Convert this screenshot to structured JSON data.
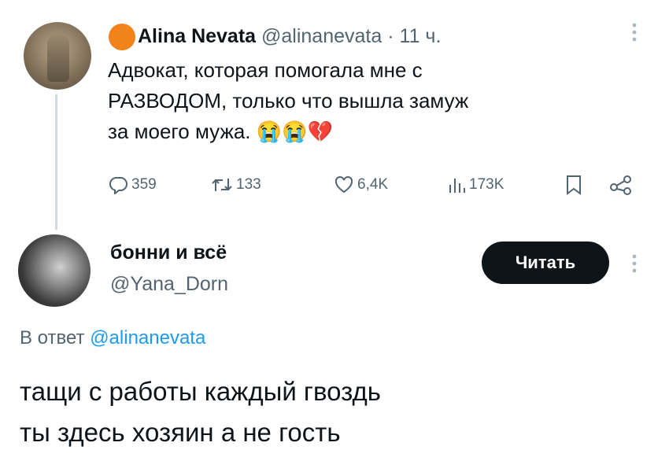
{
  "parent_tweet": {
    "author_name": "Alina Nevata",
    "author_handle": "@alinanevata",
    "separator": "·",
    "time": "11 ч.",
    "text": "Адвокат, которая помогала мне с РАЗВОДОМ, только что вышла замуж за моего мужа.",
    "emojis": "😭😭💔",
    "more_icon": "⋮",
    "actions": {
      "replies": "359",
      "reposts": "133",
      "likes": "6,4K",
      "views": "173K"
    }
  },
  "reply_tweet": {
    "author_name": "бонни и всё",
    "author_handle": "@Yana_Dorn",
    "follow_label": "Читать",
    "more_icon": "⋮",
    "reply_prefix": "В ответ",
    "reply_to_handle": "@alinanevata",
    "text_lines": [
      "тащи с работы каждый гвоздь",
      "ты здесь хозяин а не гость"
    ]
  },
  "colors": {
    "text_primary": "#0f1419",
    "text_secondary": "#536471",
    "link": "#1d9bf0",
    "button_bg": "#0f1419",
    "thread_line": "#cfd9de",
    "badge_orange": "#f2821a"
  },
  "icons": [
    "kebab-icon",
    "reply-icon",
    "repost-icon",
    "like-icon",
    "views-icon",
    "bookmark-icon",
    "share-icon"
  ]
}
